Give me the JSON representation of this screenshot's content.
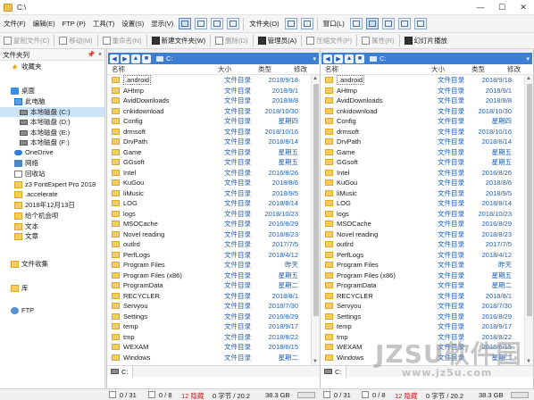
{
  "window": {
    "title": "C:\\",
    "buttons": [
      "—",
      "☐",
      "✕"
    ]
  },
  "menubar": {
    "items": [
      "文件(F)",
      "编辑(E)",
      "FTP (P)",
      "工具(T)",
      "设置(S)",
      "显示(V)"
    ],
    "folder_menu": "文件夹(O)",
    "window_menu": "窗口(L)"
  },
  "toolbar": {
    "copy": "复制文件(C)",
    "move": "移动(M)",
    "rename": "重命名(N)",
    "new_folder": "新建文件夹(W)",
    "delete": "删除(D)",
    "admin": "管理员(A)",
    "compress": "压缩文件(P)",
    "properties": "属性(R)",
    "slideshow": "幻灯片播放"
  },
  "sidebar": {
    "title": "文件夹列",
    "pin": "📌",
    "close": "×",
    "nodes": [
      {
        "label": "收藏夹",
        "icon": "star",
        "indent": 0
      },
      {
        "label": "桌面",
        "icon": "blue",
        "indent": 0
      },
      {
        "label": "此电脑",
        "icon": "pc",
        "indent": 1
      },
      {
        "label": "本地磁盘 (C:)",
        "icon": "drive",
        "indent": 2
      },
      {
        "label": "本地磁盘 (D:)",
        "icon": "drive",
        "indent": 2
      },
      {
        "label": "本地磁盘 (E:)",
        "icon": "drive",
        "indent": 2
      },
      {
        "label": "本地磁盘 (F:)",
        "icon": "drive",
        "indent": 2
      },
      {
        "label": "OneDrive",
        "icon": "cloud",
        "indent": 1
      },
      {
        "label": "网络",
        "icon": "net",
        "indent": 1
      },
      {
        "label": "回收站",
        "icon": "bin",
        "indent": 1
      },
      {
        "label": "z3 FontExpert Pro 2018",
        "icon": "folder",
        "indent": 1
      },
      {
        "label": ".accelerate",
        "icon": "folder",
        "indent": 1
      },
      {
        "label": "2018年12月13日",
        "icon": "folder",
        "indent": 1
      },
      {
        "label": "给个机会呗",
        "icon": "folder",
        "indent": 1
      },
      {
        "label": "文本",
        "icon": "folder",
        "indent": 1
      },
      {
        "label": "文章",
        "icon": "folder",
        "indent": 1
      },
      {
        "label": "文件收集",
        "icon": "folder",
        "indent": 0
      },
      {
        "label": "库",
        "icon": "folder",
        "indent": 0
      },
      {
        "label": "FTP",
        "icon": "ftp",
        "indent": 0
      }
    ]
  },
  "columns": {
    "name": "名称",
    "size": "大小",
    "type": "类型",
    "modified": "修改"
  },
  "panes": [
    {
      "path": "C:",
      "drive_tab": "C:"
    },
    {
      "path": "C:",
      "drive_tab": "C:"
    }
  ],
  "files": [
    {
      "name": ".android",
      "type": "文件目录",
      "date": "2018/9/18"
    },
    {
      "name": "AHtmp",
      "type": "文件目录",
      "date": "2018/9/1"
    },
    {
      "name": "AvidDownloads",
      "type": "文件目录",
      "date": "2018/8/8"
    },
    {
      "name": "cnkidownload",
      "type": "文件目录",
      "date": "2018/10/30"
    },
    {
      "name": "Config",
      "type": "文件目录",
      "date": "星期四"
    },
    {
      "name": "drmsoft",
      "type": "文件目录",
      "date": "2018/10/16"
    },
    {
      "name": "DrvPath",
      "type": "文件目录",
      "date": "2018/8/14"
    },
    {
      "name": "Game",
      "type": "文件目录",
      "date": "星期五"
    },
    {
      "name": "GGsoft",
      "type": "文件目录",
      "date": "星期五"
    },
    {
      "name": "Intel",
      "type": "文件目录",
      "date": "2016/8/26"
    },
    {
      "name": "KuGou",
      "type": "文件目录",
      "date": "2018/8/6"
    },
    {
      "name": "liMusic",
      "type": "文件目录",
      "date": "2018/9/5"
    },
    {
      "name": "LOG",
      "type": "文件目录",
      "date": "2018/8/14"
    },
    {
      "name": "logs",
      "type": "文件目录",
      "date": "2018/10/23"
    },
    {
      "name": "MSOCache",
      "type": "文件目录",
      "date": "2016/8/29"
    },
    {
      "name": "Novel reading",
      "type": "文件目录",
      "date": "2018/8/23"
    },
    {
      "name": "outlrd",
      "type": "文件目录",
      "date": "2017/7/5"
    },
    {
      "name": "PerfLogs",
      "type": "文件目录",
      "date": "2018/4/12"
    },
    {
      "name": "Program Files",
      "type": "文件目录",
      "date": "昨天"
    },
    {
      "name": "Program Files (x86)",
      "type": "文件目录",
      "date": "星期五"
    },
    {
      "name": "ProgramData",
      "type": "文件目录",
      "date": "星期二"
    },
    {
      "name": "RECYCLER",
      "type": "文件目录",
      "date": "2018/8/1"
    },
    {
      "name": "Servyou",
      "type": "文件目录",
      "date": "2018/7/30"
    },
    {
      "name": "Settings",
      "type": "文件目录",
      "date": "2016/8/29"
    },
    {
      "name": "temp",
      "type": "文件目录",
      "date": "2018/9/17"
    },
    {
      "name": "tmp",
      "type": "文件目录",
      "date": "2018/8/22"
    },
    {
      "name": "WEXAM",
      "type": "文件目录",
      "date": "2018/6/15"
    },
    {
      "name": "Windows",
      "type": "文件目录",
      "date": "星期二"
    }
  ],
  "status": {
    "left": {
      "files": "0 / 31",
      "selected": "0 / 8",
      "hidden": "12 隐藏",
      "bytes": "0 字节 / 20.2",
      "disk": "38.3 GB",
      "disk_used_fraction": 0.6
    },
    "right": {
      "files": "0 / 31",
      "selected": "0 / 8",
      "hidden": "12 隐藏",
      "bytes": "0 字节 / 20.2",
      "disk": "38.3 GB",
      "disk_used_fraction": 0.6
    }
  },
  "watermark": {
    "line1": "JZSU软件园",
    "line2": "www.jz5u.com"
  }
}
